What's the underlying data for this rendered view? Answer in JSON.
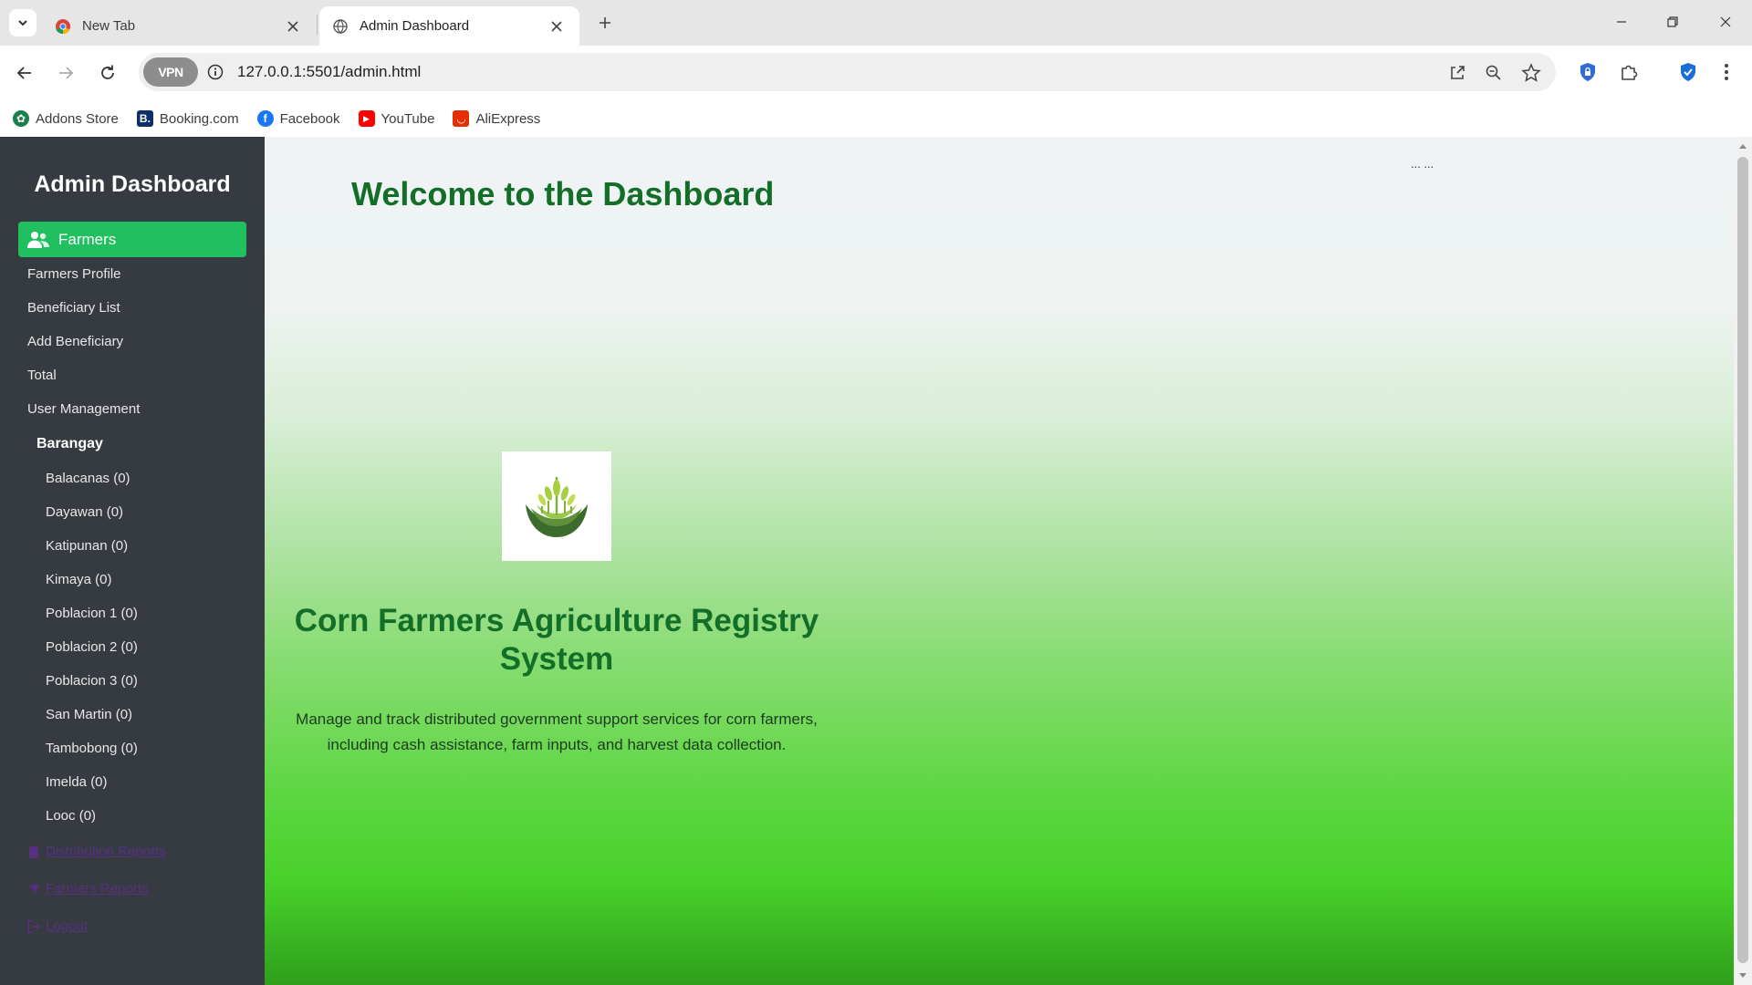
{
  "browser": {
    "tabs": [
      {
        "title": "New Tab"
      },
      {
        "title": "Admin Dashboard"
      }
    ],
    "url": "127.0.0.1:5501/admin.html",
    "vpn_label": "VPN",
    "bookmarks": [
      {
        "label": "Addons Store",
        "icon": "addons-store-icon",
        "color": "#1a7f4b"
      },
      {
        "label": "Booking.com",
        "icon": "booking-icon",
        "color": "#0c2f6b"
      },
      {
        "label": "Facebook",
        "icon": "facebook-icon",
        "color": "#1877f2"
      },
      {
        "label": "YouTube",
        "icon": "youtube-icon",
        "color": "#ff0000"
      },
      {
        "label": "AliExpress",
        "icon": "aliexpress-icon",
        "color": "#e62e04"
      }
    ]
  },
  "sidebar": {
    "title": "Admin Dashboard",
    "active_item": "Farmers",
    "links": [
      "Farmers Profile",
      "Beneficiary List",
      "Add Beneficiary",
      "Total",
      "User Management"
    ],
    "section_label": "Barangay",
    "barangays": [
      "Balacanas (0)",
      "Dayawan (0)",
      "Katipunan (0)",
      "Kimaya (0)",
      "Poblacion 1 (0)",
      "Poblacion 2 (0)",
      "Poblacion 3 (0)",
      "San Martin (0)",
      "Tambobong (0)",
      "Imelda (0)",
      "Looc (0)"
    ],
    "bottom_links": [
      "Distribution Reports",
      "Farmers Reports",
      "Logout"
    ],
    "active_color": "#20c060",
    "bg_color": "#353b40"
  },
  "main": {
    "welcome": "Welcome to the Dashboard",
    "dots": "... ...",
    "system_title": "Corn Farmers Agriculture Registry System",
    "description_line1": "Manage and track distributed government support services for corn farmers,",
    "description_line2": "including cash assistance, farm inputs, and harvest data collection.",
    "heading_color": "#136e28"
  }
}
